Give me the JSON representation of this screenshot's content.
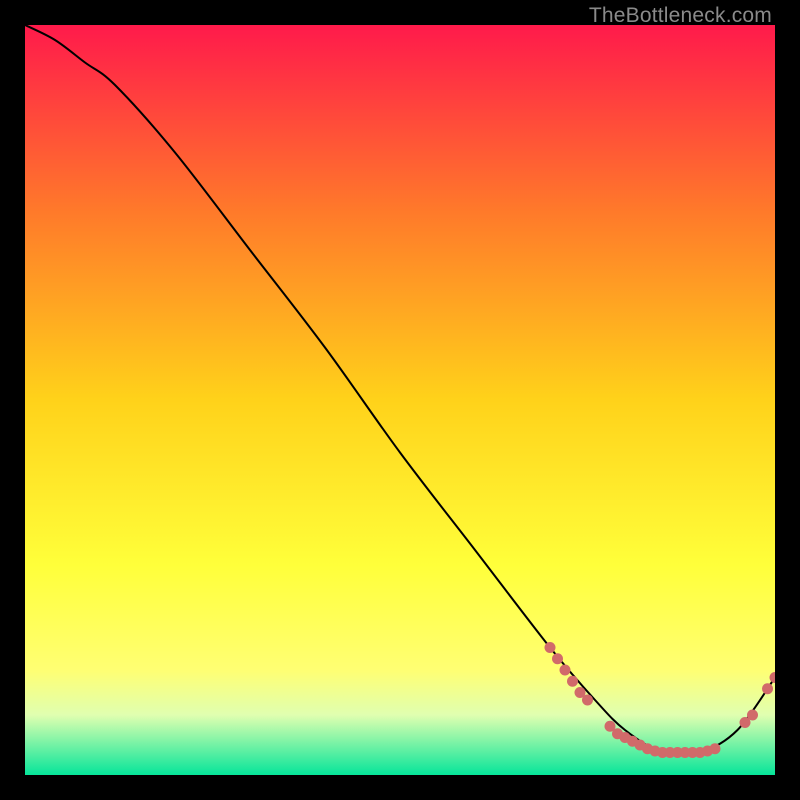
{
  "watermark": "TheBottleneck.com",
  "chart_data": {
    "type": "line",
    "title": "",
    "xlabel": "",
    "ylabel": "",
    "xlim": [
      0,
      100
    ],
    "ylim": [
      0,
      100
    ],
    "grid": false,
    "legend": null,
    "background_gradient": {
      "stops": [
        {
          "pos": 0.0,
          "color": "#ff1a4b"
        },
        {
          "pos": 0.25,
          "color": "#ff7a2a"
        },
        {
          "pos": 0.5,
          "color": "#ffd21a"
        },
        {
          "pos": 0.72,
          "color": "#ffff3a"
        },
        {
          "pos": 0.86,
          "color": "#ffff73"
        },
        {
          "pos": 0.92,
          "color": "#e0ffb0"
        },
        {
          "pos": 1.0,
          "color": "#06e59a"
        }
      ]
    },
    "series": [
      {
        "name": "bottleneck-curve",
        "color": "#000000",
        "x": [
          0,
          4,
          8,
          12,
          20,
          30,
          40,
          50,
          60,
          70,
          76,
          80,
          85,
          90,
          95,
          100
        ],
        "y": [
          100,
          98,
          95,
          92,
          83,
          70,
          57,
          43,
          30,
          17,
          10,
          6,
          3,
          3,
          6,
          13
        ]
      }
    ],
    "markers": [
      {
        "name": "marker-group-left",
        "color": "#d16a6a",
        "points": [
          [
            70,
            17
          ],
          [
            71,
            15.5
          ],
          [
            72,
            14
          ],
          [
            73,
            12.5
          ],
          [
            74,
            11
          ],
          [
            75,
            10
          ]
        ]
      },
      {
        "name": "marker-group-floor",
        "color": "#d16a6a",
        "points": [
          [
            78,
            6.5
          ],
          [
            79,
            5.5
          ],
          [
            80,
            5
          ],
          [
            81,
            4.5
          ],
          [
            82,
            4
          ],
          [
            83,
            3.5
          ],
          [
            84,
            3.2
          ],
          [
            85,
            3
          ],
          [
            86,
            3
          ],
          [
            87,
            3
          ],
          [
            88,
            3
          ],
          [
            89,
            3
          ],
          [
            90,
            3
          ],
          [
            91,
            3.2
          ],
          [
            92,
            3.5
          ]
        ]
      },
      {
        "name": "marker-group-rise",
        "color": "#d16a6a",
        "points": [
          [
            96,
            7
          ],
          [
            97,
            8
          ],
          [
            99,
            11.5
          ],
          [
            100,
            13
          ]
        ]
      }
    ]
  }
}
